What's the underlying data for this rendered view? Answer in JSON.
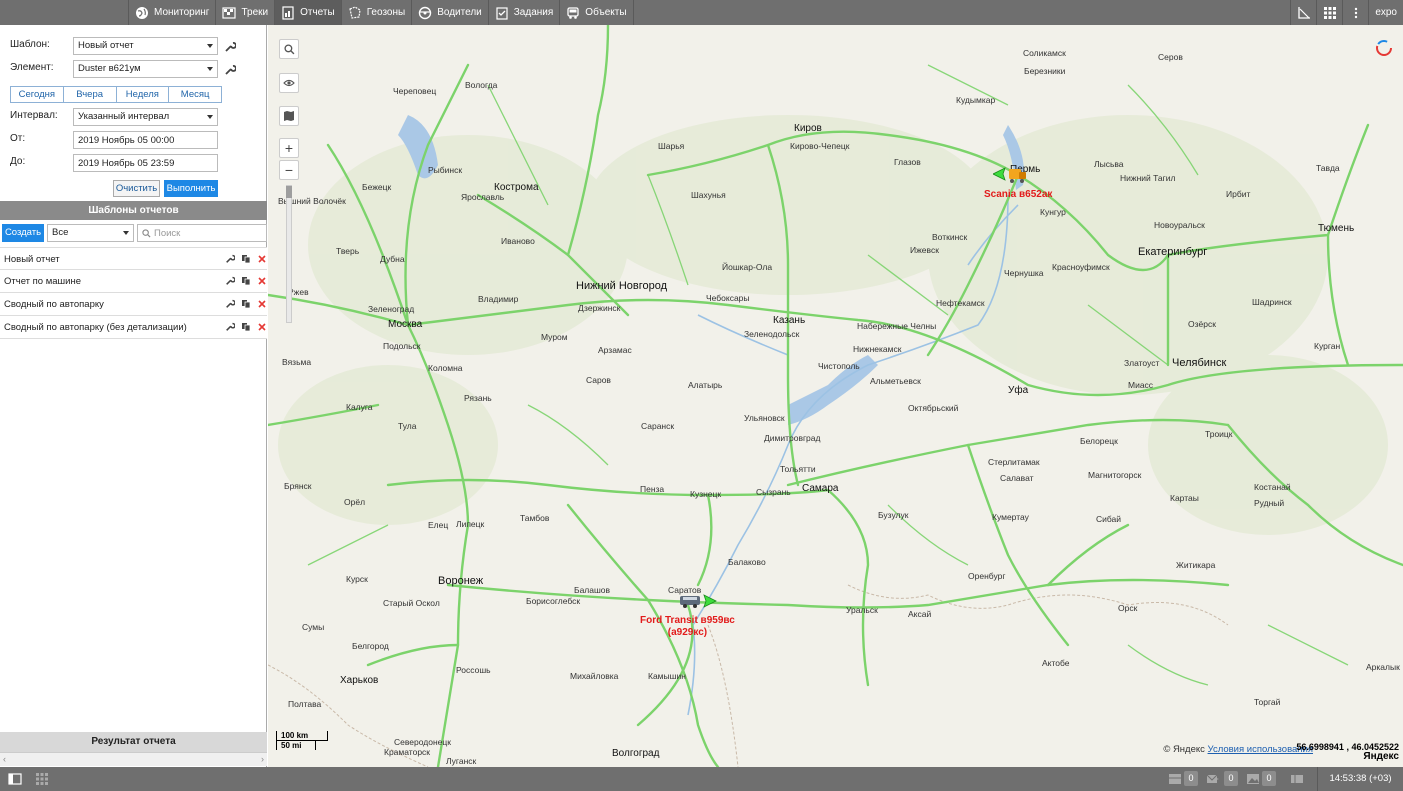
{
  "nav": {
    "items": [
      {
        "label": "Мониторинг",
        "icon": "globe-icon"
      },
      {
        "label": "Треки",
        "icon": "track-flag-icon"
      },
      {
        "label": "Отчеты",
        "icon": "report-icon"
      },
      {
        "label": "Геозоны",
        "icon": "geofence-icon"
      },
      {
        "label": "Водители",
        "icon": "driver-icon"
      },
      {
        "label": "Задания",
        "icon": "task-icon"
      },
      {
        "label": "Объекты",
        "icon": "vehicle-icon"
      }
    ]
  },
  "topright": {
    "user": "expo",
    "icons": [
      "ruler-icon",
      "apps-grid-icon",
      "more-vertical-icon"
    ]
  },
  "report_form": {
    "template_label": "Шаблон:",
    "template_value": "Новый отчет",
    "element_label": "Элемент:",
    "element_value": "Duster в621ум",
    "period_tabs": [
      "Сегодня",
      "Вчера",
      "Неделя",
      "Месяц"
    ],
    "interval_label": "Интервал:",
    "interval_value": "Указанный интервал",
    "from_label": "От:",
    "from_value": "2019 Ноябрь 05 00:00",
    "to_label": "До:",
    "to_value": "2019 Ноябрь 05 23:59",
    "clear_label": "Очистить",
    "run_label": "Выполнить"
  },
  "templates": {
    "header": "Шаблоны отчетов",
    "create_label": "Создать",
    "filter_value": "Все",
    "search_placeholder": "Поиск",
    "items": [
      "Новый отчет",
      "Отчет по машине",
      "Сводный по автопарку",
      "Сводный по автопарку (без детализации)"
    ]
  },
  "result": {
    "header": "Результат отчета"
  },
  "map": {
    "cities": [
      {
        "name": "Соликамск"
      },
      {
        "name": "Березники"
      },
      {
        "name": "Серов"
      },
      {
        "name": "Череповец"
      },
      {
        "name": "Вологда"
      },
      {
        "name": "Кудымкар"
      },
      {
        "name": "Рыбинск"
      },
      {
        "name": "Киров"
      },
      {
        "name": "Кирово-Чепецк"
      },
      {
        "name": "Шарья"
      },
      {
        "name": "Глазов"
      },
      {
        "name": "Пермь"
      },
      {
        "name": "Лысьва"
      },
      {
        "name": "Нижний Тагил"
      },
      {
        "name": "Тавда"
      },
      {
        "name": "Бежецк"
      },
      {
        "name": "Кострома"
      },
      {
        "name": "Ярославль"
      },
      {
        "name": "Шахунья"
      },
      {
        "name": "Ирбит"
      },
      {
        "name": "Вышний Волочёк"
      },
      {
        "name": "Кунгур"
      },
      {
        "name": "Новоуральск"
      },
      {
        "name": "Воткинск"
      },
      {
        "name": "Тюмень"
      },
      {
        "name": "Иваново"
      },
      {
        "name": "Ижевск"
      },
      {
        "name": "Екатеринбург"
      },
      {
        "name": "Тверь"
      },
      {
        "name": "Дубна"
      },
      {
        "name": "Йошкар-Ола"
      },
      {
        "name": "Чернушка"
      },
      {
        "name": "Красноуфимск"
      },
      {
        "name": "Нижний Новгород"
      },
      {
        "name": "Ржев"
      },
      {
        "name": "Владимир"
      },
      {
        "name": "Чебоксары"
      },
      {
        "name": "Шадринск"
      },
      {
        "name": "Зеленоград"
      },
      {
        "name": "Дзержинск"
      },
      {
        "name": "Нефтекамск"
      },
      {
        "name": "Казань"
      },
      {
        "name": "Москва"
      },
      {
        "name": "Зеленодольск"
      },
      {
        "name": "Набережные Челны"
      },
      {
        "name": "Озёрск"
      },
      {
        "name": "Подольск"
      },
      {
        "name": "Муром"
      },
      {
        "name": "Нижнекамск"
      },
      {
        "name": "Курган"
      },
      {
        "name": "Вязьма"
      },
      {
        "name": "Арзамас"
      },
      {
        "name": "Чистополь"
      },
      {
        "name": "Златоуст"
      },
      {
        "name": "Челябинск"
      },
      {
        "name": "Коломна"
      },
      {
        "name": "Саров"
      },
      {
        "name": "Альметьевск"
      },
      {
        "name": "Миасс"
      },
      {
        "name": "Алатырь"
      },
      {
        "name": "Уфа"
      },
      {
        "name": "Калуга"
      },
      {
        "name": "Рязань"
      },
      {
        "name": "Ульяновск"
      },
      {
        "name": "Октябрьский"
      },
      {
        "name": "Тула"
      },
      {
        "name": "Саранск"
      },
      {
        "name": "Димитровград"
      },
      {
        "name": "Троицк"
      },
      {
        "name": "Белорецк"
      },
      {
        "name": "Стерлитамак"
      },
      {
        "name": "Тольятти"
      },
      {
        "name": "Магнитогорск"
      },
      {
        "name": "Салават"
      },
      {
        "name": "Брянск"
      },
      {
        "name": "Пенза"
      },
      {
        "name": "Кузнецк"
      },
      {
        "name": "Сызрань"
      },
      {
        "name": "Самара"
      },
      {
        "name": "Костанай"
      },
      {
        "name": "Орёл"
      },
      {
        "name": "Рудный"
      },
      {
        "name": "Картаы"
      },
      {
        "name": "Бузулук"
      },
      {
        "name": "Кумертау"
      },
      {
        "name": "Сибай"
      },
      {
        "name": "Елец"
      },
      {
        "name": "Липецк"
      },
      {
        "name": "Тамбов"
      },
      {
        "name": "Балаково"
      },
      {
        "name": "Житикара"
      },
      {
        "name": "Курск"
      },
      {
        "name": "Воронеж"
      },
      {
        "name": "Оренбург"
      },
      {
        "name": "Балашов"
      },
      {
        "name": "Саратов"
      },
      {
        "name": "Старый Оскол"
      },
      {
        "name": "Борисоглебск"
      },
      {
        "name": "Орск"
      },
      {
        "name": "Уральск"
      },
      {
        "name": "Аксай"
      },
      {
        "name": "Сумы"
      },
      {
        "name": "Белгород"
      },
      {
        "name": "Россошь"
      },
      {
        "name": "Михайловка"
      },
      {
        "name": "Камышин"
      },
      {
        "name": "Актобе"
      },
      {
        "name": "Аркалык"
      },
      {
        "name": "Харьков"
      },
      {
        "name": "Полтава"
      },
      {
        "name": "Торгай"
      },
      {
        "name": "Северодонецк"
      },
      {
        "name": "Краматорск"
      },
      {
        "name": "Волгоград"
      },
      {
        "name": "Луганск"
      }
    ],
    "vehicles": [
      {
        "label": "Scania в652ак"
      },
      {
        "label_line1": "Ford Transit в959вс",
        "label_line2": "(а929кс)"
      }
    ],
    "scale_km": "100 km",
    "scale_mi": "50 mi",
    "copyright": "© Яндекс",
    "terms": "Условия использования",
    "yandex_logo": "Яндекс",
    "coordinates": "56.6998941 , 46.0452522"
  },
  "bottombar": {
    "counts": [
      "0",
      "0",
      "0"
    ],
    "time": "14:53:38 (+03)"
  },
  "colors": {
    "topbar": "#6f6f6f",
    "accent": "#1e88e5",
    "road": "#7cd36b",
    "vehicle_label": "#e21b1b"
  }
}
